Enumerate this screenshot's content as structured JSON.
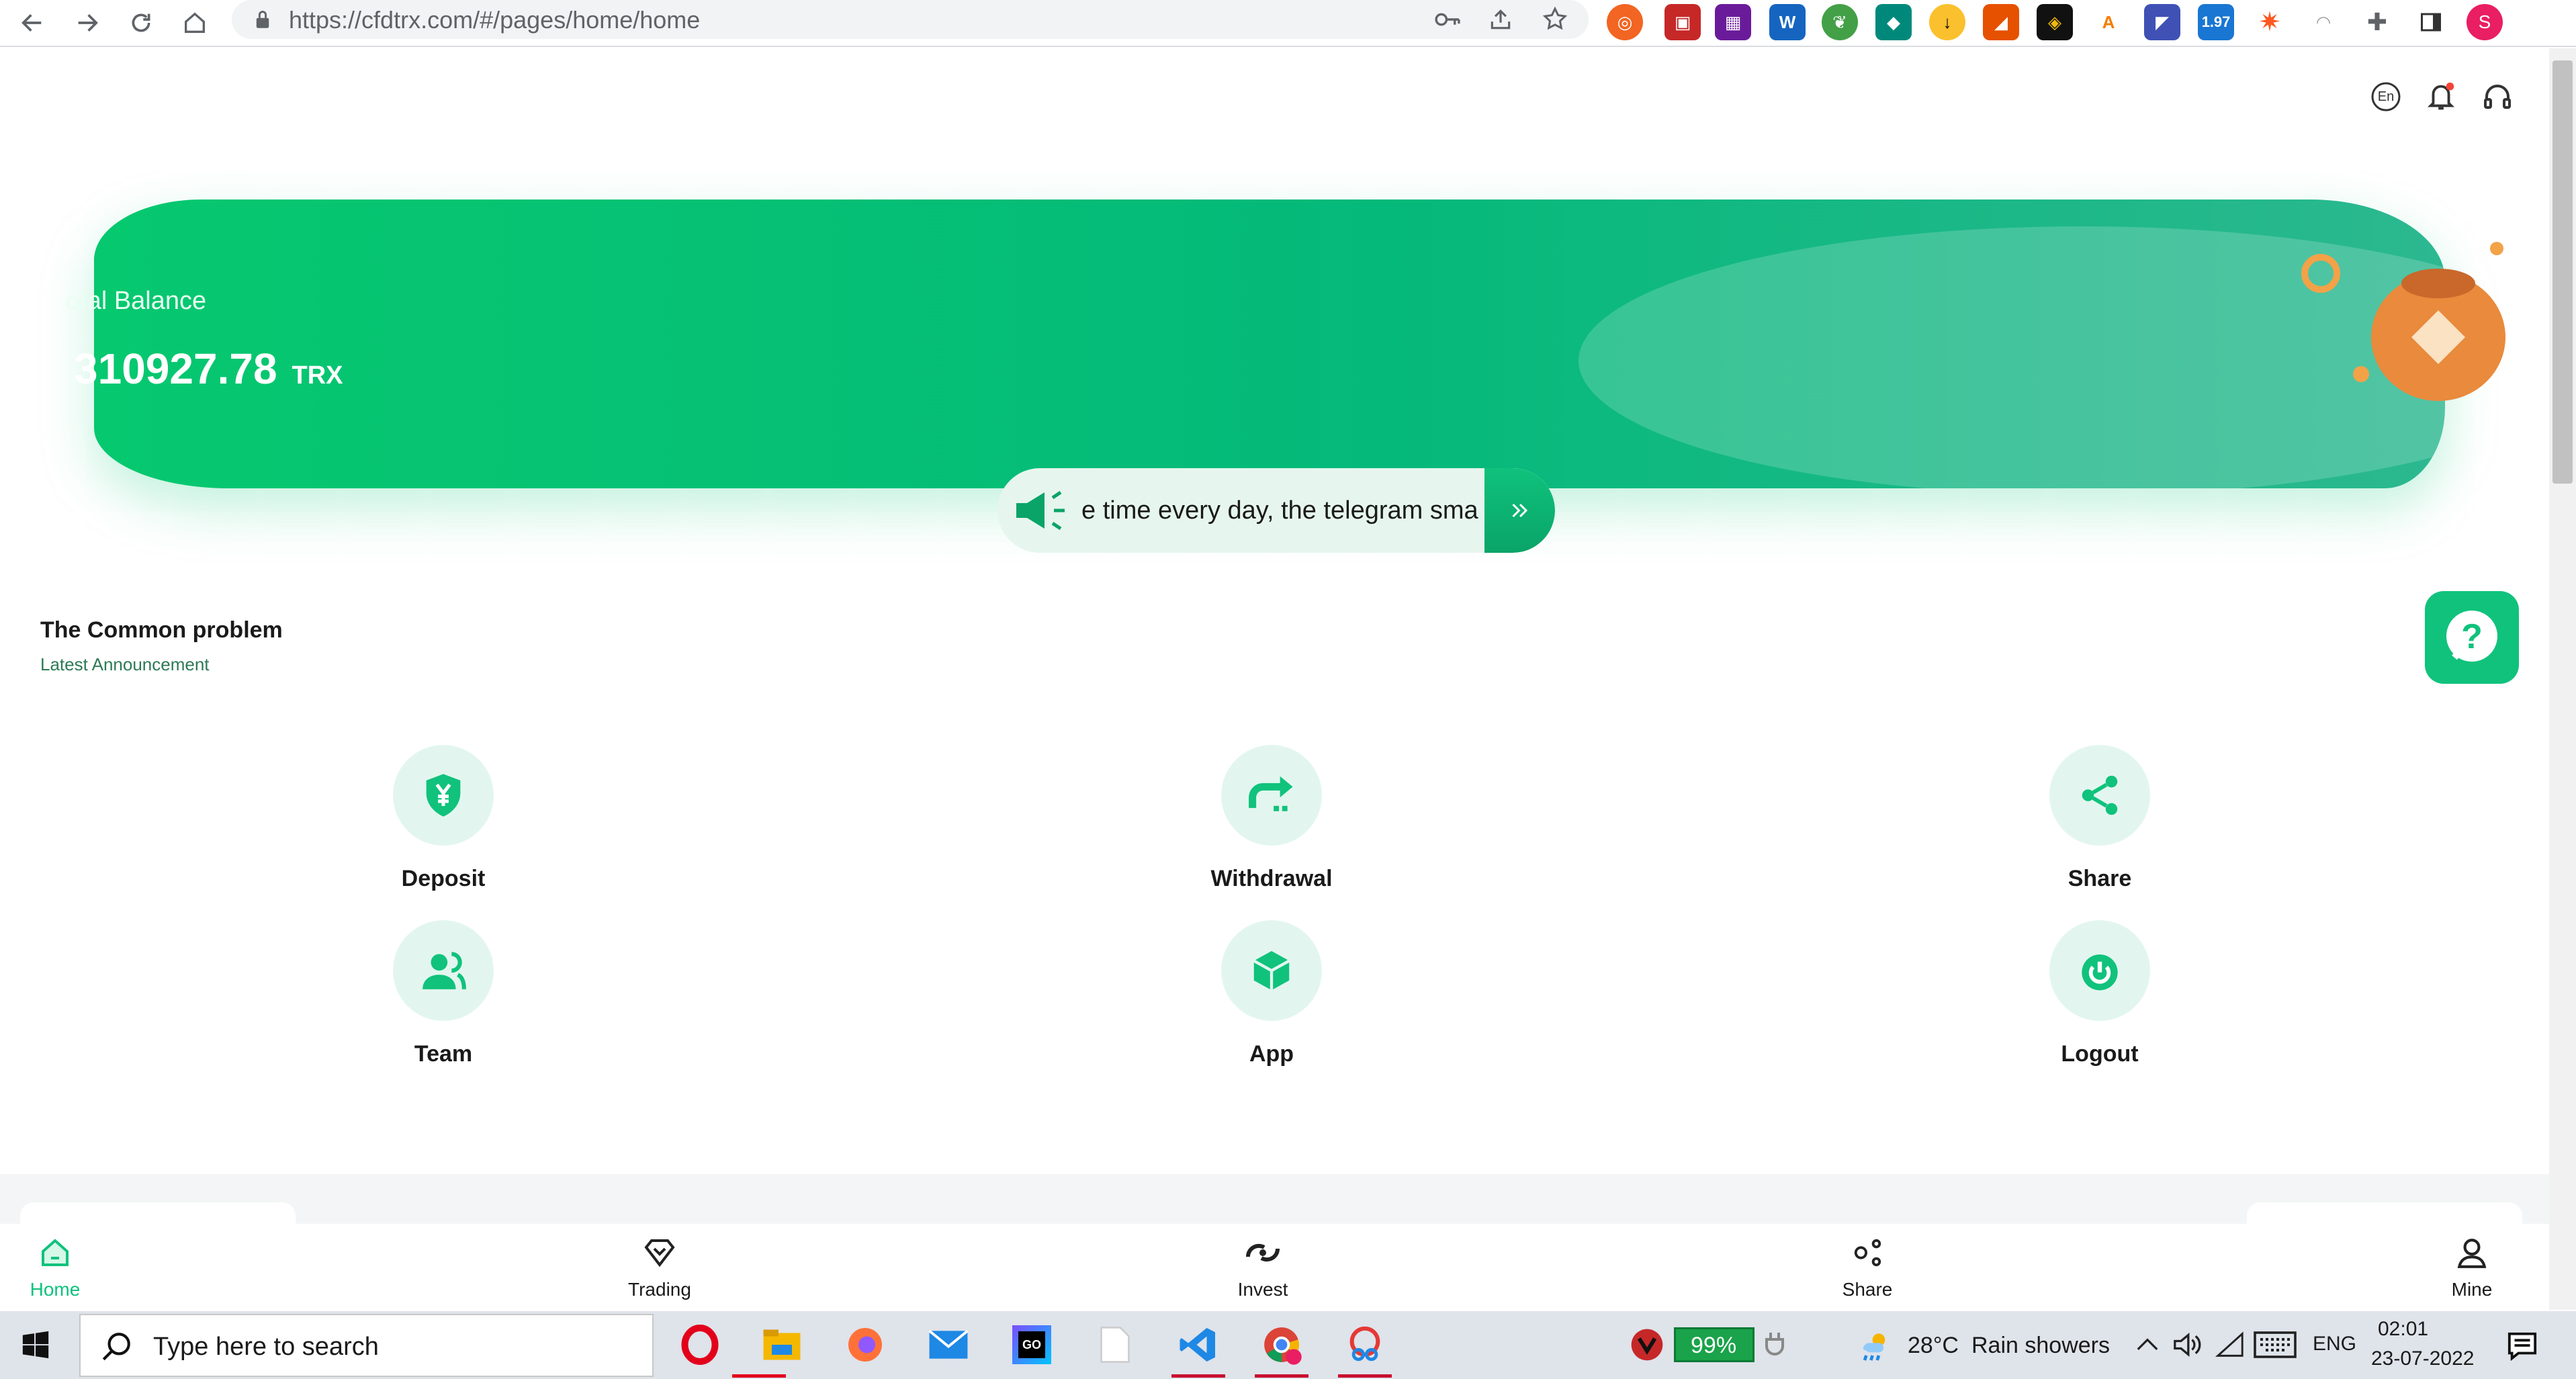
{
  "browser": {
    "url": "https://cfdtrx.com/#/pages/home/home",
    "extension_badge": "1.97",
    "profile_initial": "S"
  },
  "header": {
    "language_label": "En"
  },
  "banner": {
    "label": "otal Balance",
    "balance": "310927.78",
    "unit": "TRX"
  },
  "marquee": {
    "text": "e time every day, the telegram sma"
  },
  "section": {
    "title": "The Common problem",
    "subtitle": "Latest Announcement"
  },
  "menu": [
    {
      "label": "Deposit",
      "icon": "shield-yuan-icon"
    },
    {
      "label": "Withdrawal",
      "icon": "withdraw-arrow-icon"
    },
    {
      "label": "Share",
      "icon": "share-nodes-icon"
    },
    {
      "label": "Team",
      "icon": "team-users-icon"
    },
    {
      "label": "App",
      "icon": "cube-icon"
    },
    {
      "label": "Logout",
      "icon": "power-icon"
    }
  ],
  "tabs": [
    {
      "label": "Home",
      "icon": "home-icon",
      "active": true
    },
    {
      "label": "Trading",
      "icon": "diamond-icon",
      "active": false
    },
    {
      "label": "Invest",
      "icon": "invest-icon",
      "active": false
    },
    {
      "label": "Share",
      "icon": "share-icon",
      "active": false
    },
    {
      "label": "Mine",
      "icon": "user-icon",
      "active": false
    }
  ],
  "colors": {
    "accent": "#10c27c",
    "accent_light": "#e2f6ef",
    "taskbar": "#dfe3ea"
  },
  "taskbar": {
    "search_placeholder": "Type here to search",
    "battery": "99%",
    "weather_temp": "28°C",
    "weather_desc": "Rain showers",
    "language": "ENG",
    "time": "02:01",
    "date": "23-07-2022"
  }
}
